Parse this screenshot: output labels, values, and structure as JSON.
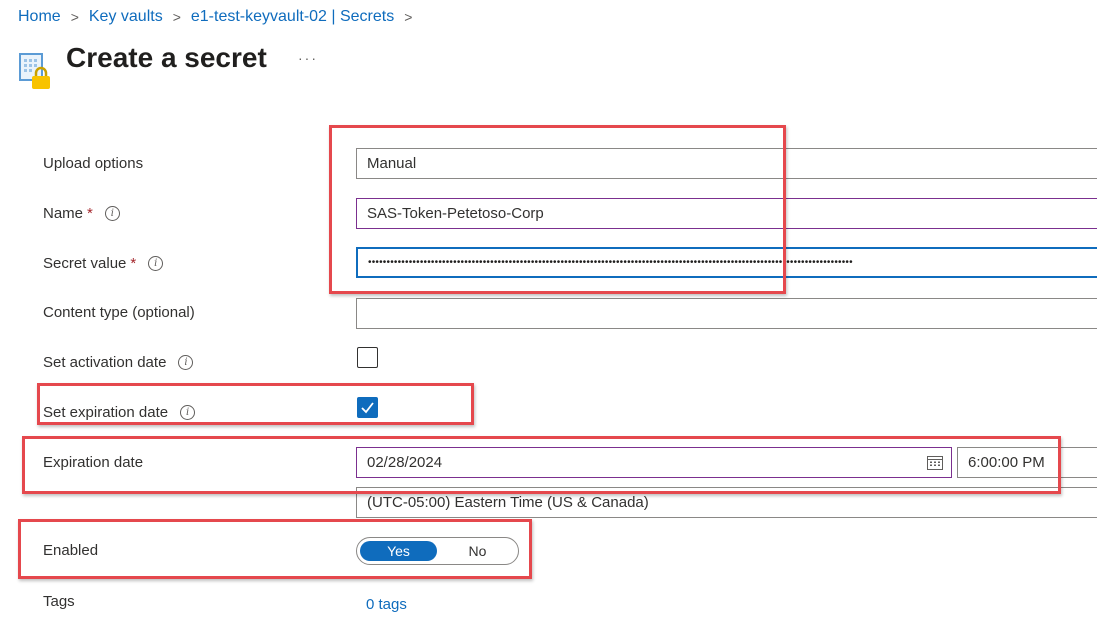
{
  "breadcrumb": {
    "home": "Home",
    "key_vaults": "Key vaults",
    "resource": "e1-test-keyvault-02 | Secrets",
    "sep": ">"
  },
  "title": "Create a secret",
  "more_label": "···",
  "form": {
    "upload_options": {
      "label": "Upload options",
      "value": "Manual"
    },
    "name": {
      "label": "Name",
      "required": "*",
      "value": "SAS-Token-Petetoso-Corp"
    },
    "secret_value": {
      "label": "Secret value",
      "required": "*",
      "masked": "•••••••••••••••••••••••••••••••••••••••••••••••••••••••••••••••••••••••••••••••••••••••••••••••••••••••••••••••••••••••••••••••••••"
    },
    "content_type": {
      "label": "Content type (optional)",
      "value": ""
    },
    "activation": {
      "label": "Set activation date",
      "checked": false
    },
    "expiration_toggle": {
      "label": "Set expiration date",
      "checked": true
    },
    "expiration_date": {
      "label": "Expiration date",
      "date": "02/28/2024",
      "time": "6:00:00 PM",
      "timezone": "(UTC-05:00) Eastern Time (US & Canada)"
    },
    "enabled": {
      "label": "Enabled",
      "yes": "Yes",
      "no": "No",
      "selected": "Yes"
    },
    "tags": {
      "label": "Tags",
      "link": "0 tags"
    }
  },
  "info_glyph": "i",
  "colors": {
    "accent": "#0f6cbd",
    "highlight": "#e5484d",
    "required": "#a4262c"
  }
}
